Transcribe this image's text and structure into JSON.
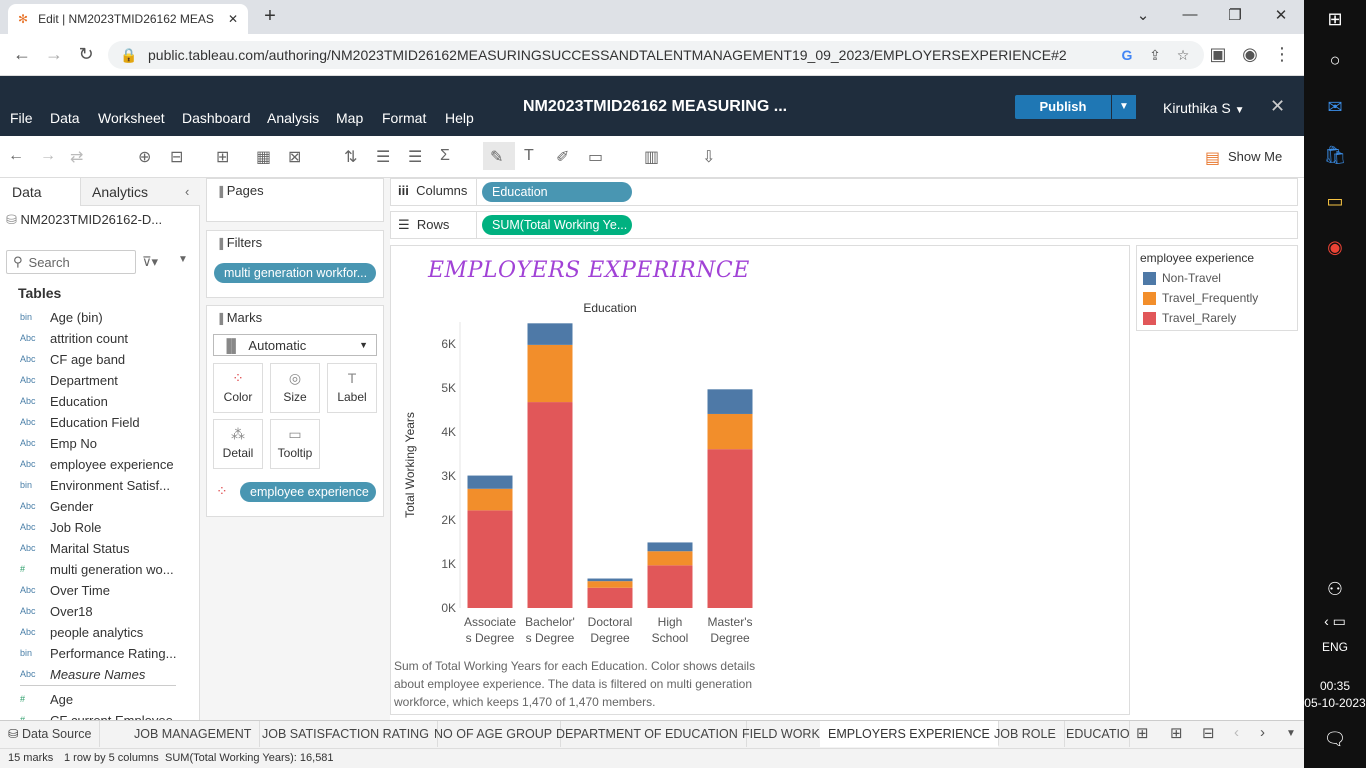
{
  "browser": {
    "tab_title": "Edit | NM2023TMID26162 MEAS",
    "url": "public.tableau.com/authoring/NM2023TMID26162MEASURINGSUCCESSANDTALENTMANAGEMENT19_09_2023/EMPLOYERSEXPERIENCE#2"
  },
  "taskbar": {
    "lang": "ENG",
    "time": "00:35",
    "date": "05-10-2023"
  },
  "header": {
    "menus": [
      "File",
      "Data",
      "Worksheet",
      "Dashboard",
      "Analysis",
      "Map",
      "Format",
      "Help"
    ],
    "workbook_title": "NM2023TMID26162 MEASURING ...",
    "publish_label": "Publish",
    "user": "Kiruthika S"
  },
  "toolbar": {
    "show_me": "Show Me"
  },
  "data_pane": {
    "tabs": [
      "Data",
      "Analytics"
    ],
    "datasource": "NM2023TMID26162-D...",
    "search_placeholder": "Search",
    "tables_header": "Tables",
    "fields": [
      {
        "type": "bin",
        "name": "Age (bin)"
      },
      {
        "type": "Abc",
        "name": "attrition count"
      },
      {
        "type": "Abc",
        "name": "CF age band"
      },
      {
        "type": "Abc",
        "name": "Department"
      },
      {
        "type": "Abc",
        "name": "Education"
      },
      {
        "type": "Abc",
        "name": "Education Field"
      },
      {
        "type": "Abc",
        "name": "Emp No"
      },
      {
        "type": "Abc",
        "name": "employee experience"
      },
      {
        "type": "bin",
        "name": "Environment Satisf..."
      },
      {
        "type": "Abc",
        "name": "Gender"
      },
      {
        "type": "Abc",
        "name": "Job Role"
      },
      {
        "type": "Abc",
        "name": "Marital Status"
      },
      {
        "type": "#",
        "name": "multi generation wo..."
      },
      {
        "type": "Abc",
        "name": "Over Time"
      },
      {
        "type": "Abc",
        "name": "Over18"
      },
      {
        "type": "Abc",
        "name": "people analytics"
      },
      {
        "type": "bin",
        "name": "Performance Rating..."
      },
      {
        "type": "Abc",
        "name": "Measure Names"
      },
      {
        "type": "#",
        "name": "Age"
      },
      {
        "type": "#",
        "name": "CF current Employee..."
      }
    ]
  },
  "cards": {
    "pages_title": "Pages",
    "filters_title": "Filters",
    "filter_pill": "multi generation workfor...",
    "marks_title": "Marks",
    "mark_type": "Automatic",
    "buttons": [
      "Color",
      "Size",
      "Label",
      "Detail",
      "Tooltip"
    ],
    "color_pill": "employee experience"
  },
  "shelves": {
    "columns_label": "Columns",
    "columns_pill": "Education",
    "rows_label": "Rows",
    "rows_pill": "SUM(Total Working Ye..."
  },
  "view": {
    "sheet_title": "EMPLOYERS EXPERIRNCE",
    "caption": "Sum of Total Working Years for each Education.  Color shows details about employee experience. The data is filtered on multi generation workforce, which keeps 1,470 of 1,470 members."
  },
  "legend": {
    "title": "employee experience",
    "items": [
      {
        "label": "Non-Travel",
        "color": "#4e79a7"
      },
      {
        "label": "Travel_Frequently",
        "color": "#f28e2b"
      },
      {
        "label": "Travel_Rarely",
        "color": "#e15759"
      }
    ]
  },
  "chart_data": {
    "type": "bar",
    "stacked": true,
    "title": "Education",
    "xlabel": "",
    "ylabel": "Total Working Years",
    "categories": [
      [
        "Associate",
        "s Degree"
      ],
      [
        "Bachelor'",
        "s Degree"
      ],
      [
        "Doctoral",
        "Degree"
      ],
      [
        "High",
        "School"
      ],
      [
        "Master's",
        "Degree"
      ]
    ],
    "series": [
      {
        "name": "Travel_Rarely",
        "color": "#e15759",
        "values": [
          2220,
          4680,
          460,
          970,
          3610
        ]
      },
      {
        "name": "Travel_Frequently",
        "color": "#f28e2b",
        "values": [
          490,
          1300,
          150,
          320,
          800
        ]
      },
      {
        "name": "Non-Travel",
        "color": "#4e79a7",
        "values": [
          300,
          490,
          60,
          200,
          560
        ]
      }
    ],
    "ylim": [
      0,
      6500
    ],
    "yticks": [
      0,
      1000,
      2000,
      3000,
      4000,
      5000,
      6000
    ],
    "ytick_labels": [
      "0K",
      "1K",
      "2K",
      "3K",
      "4K",
      "5K",
      "6K"
    ],
    "grid": false
  },
  "sheet_tabs": {
    "data_source": "Data Source",
    "tabs": [
      "JOB MANAGEMENT",
      "JOB SATISFACTION RATING",
      "NO OF AGE GROUP",
      "DEPARTMENT OF EDUCATION",
      "FIELD WORK",
      "EMPLOYERS EXPERIENCE",
      "JOB ROLE",
      "EDUCATION"
    ],
    "active": "EMPLOYERS EXPERIENCE"
  },
  "status": {
    "marks": "15 marks",
    "rows_cols": "1 row by 5 columns",
    "sum": "SUM(Total Working Years): 16,581"
  }
}
